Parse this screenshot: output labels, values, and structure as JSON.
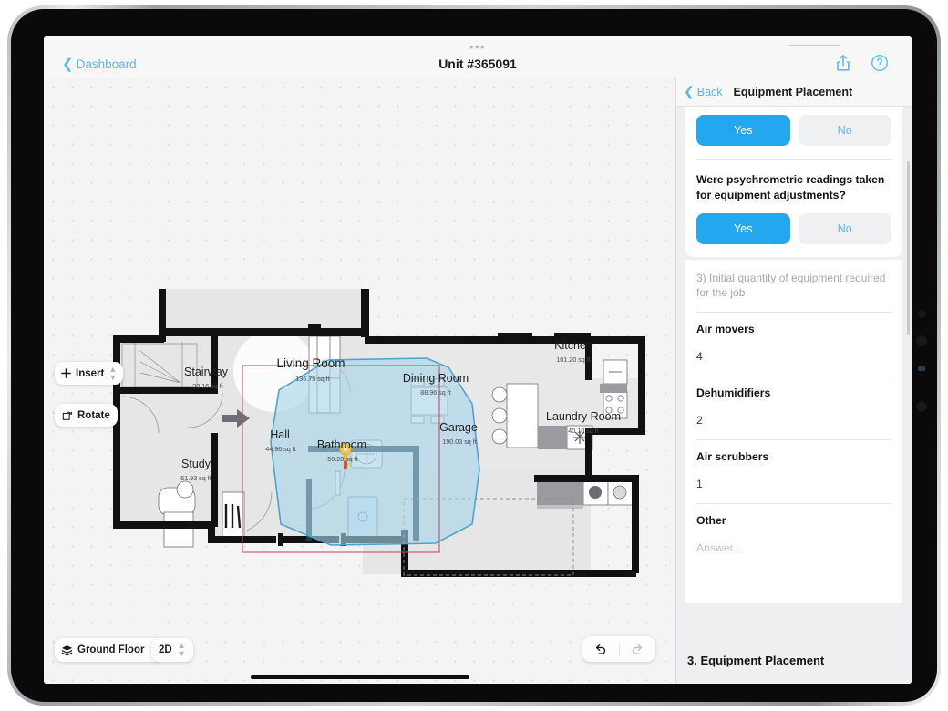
{
  "topbar": {
    "back_label": "Dashboard",
    "title": "Unit #365091",
    "share_icon": "share-icon",
    "help_icon": "help-circle-icon",
    "grabber": "•••"
  },
  "canvas": {
    "tools": {
      "insert_label": "Insert",
      "rotate_label": "Rotate",
      "floor_label": "Ground Floor",
      "view_label": "2D",
      "undo_icon": "undo-arrow-icon",
      "redo_icon": "redo-arrow-icon",
      "layers_icon": "layers-icon",
      "plus_icon": "plus-icon",
      "rotate_icon": "rotate-square-icon",
      "marker_icon": "key-marker-icon"
    },
    "rooms": [
      {
        "name": "Living Room",
        "area": "136.75 sq ft"
      },
      {
        "name": "Stairway",
        "area": "38.16 sq ft"
      },
      {
        "name": "Study",
        "area": "61.93 sq ft"
      },
      {
        "name": "Hall",
        "area": "44.96 sq ft"
      },
      {
        "name": "Bathroom",
        "area": "50.28 sq ft"
      },
      {
        "name": "Dining Room",
        "area": "88.96 sq ft"
      },
      {
        "name": "Garage",
        "area": "190.03 sq ft"
      },
      {
        "name": "Kitchen",
        "area": "101.20 sq ft"
      },
      {
        "name": "Laundry Room",
        "area": "40.10 sq ft"
      }
    ],
    "colors": {
      "wall": "#111113",
      "selection_fill": "#a8d3e8",
      "selection_stroke": "#4ea4cc",
      "crop_rect": "#c4525f",
      "room_fill": "#e6e6e7"
    }
  },
  "panel": {
    "back_label": "Back",
    "title": "Equipment Placement",
    "top_yes": "Yes",
    "top_no": "No",
    "question": "Were psychrometric readings taken for equipment adjustments?",
    "q_yes": "Yes",
    "q_no": "No",
    "section_note": "3) Initial quantity of equipment required for the job",
    "fields": [
      {
        "label": "Air movers",
        "value": "4"
      },
      {
        "label": "Dehumidifiers",
        "value": "2"
      },
      {
        "label": "Air scrubbers",
        "value": "1"
      },
      {
        "label": "Other",
        "value": "Answer..."
      }
    ],
    "footer": "3. Equipment Placement",
    "accent": "#22a7f0"
  }
}
